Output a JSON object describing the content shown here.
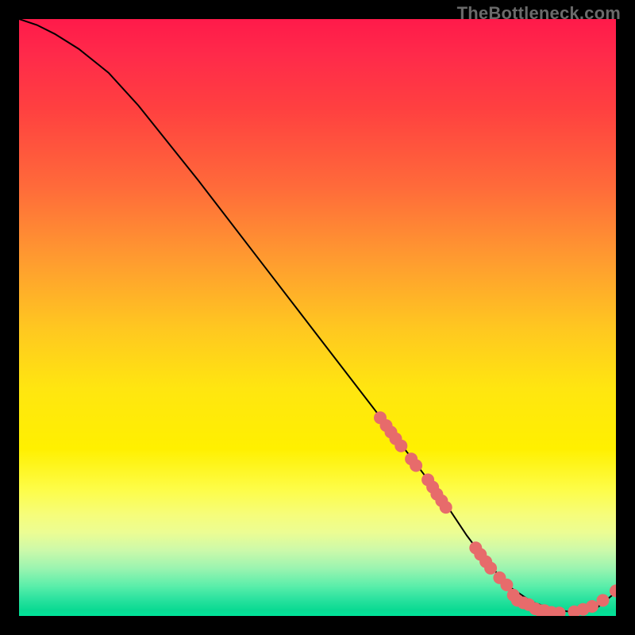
{
  "watermark": "TheBottleneck.com",
  "chart_data": {
    "type": "line",
    "title": "",
    "xlabel": "",
    "ylabel": "",
    "xlim": [
      0,
      100
    ],
    "ylim": [
      0,
      100
    ],
    "grid": false,
    "series": [
      {
        "name": "curve",
        "x": [
          0,
          3,
          6,
          10,
          15,
          20,
          30,
          40,
          50,
          60,
          68,
          72,
          75,
          78,
          82,
          86,
          90,
          94,
          97,
          100
        ],
        "y": [
          100,
          99,
          97.5,
          95,
          91,
          85.5,
          73,
          60,
          47,
          34,
          23.5,
          18,
          13.5,
          9.5,
          5,
          2.3,
          1,
          0.5,
          1.5,
          4
        ]
      }
    ],
    "markers": [
      {
        "x": 60.5,
        "y": 33.2
      },
      {
        "x": 61.5,
        "y": 31.9
      },
      {
        "x": 62.3,
        "y": 30.8
      },
      {
        "x": 63.1,
        "y": 29.7
      },
      {
        "x": 64.0,
        "y": 28.5
      },
      {
        "x": 65.7,
        "y": 26.3
      },
      {
        "x": 66.5,
        "y": 25.2
      },
      {
        "x": 68.5,
        "y": 22.8
      },
      {
        "x": 69.3,
        "y": 21.6
      },
      {
        "x": 70.0,
        "y": 20.4
      },
      {
        "x": 70.8,
        "y": 19.3
      },
      {
        "x": 71.5,
        "y": 18.2
      },
      {
        "x": 76.5,
        "y": 11.4
      },
      {
        "x": 77.3,
        "y": 10.3
      },
      {
        "x": 78.2,
        "y": 9.1
      },
      {
        "x": 79.0,
        "y": 8.0
      },
      {
        "x": 80.5,
        "y": 6.4
      },
      {
        "x": 81.7,
        "y": 5.2
      },
      {
        "x": 82.8,
        "y": 3.5
      },
      {
        "x": 83.5,
        "y": 2.6
      },
      {
        "x": 84.5,
        "y": 2.2
      },
      {
        "x": 85.4,
        "y": 1.9
      },
      {
        "x": 86.5,
        "y": 1.2
      },
      {
        "x": 87.3,
        "y": 0.9
      },
      {
        "x": 88.0,
        "y": 0.9
      },
      {
        "x": 89.2,
        "y": 0.6
      },
      {
        "x": 90.5,
        "y": 0.5
      },
      {
        "x": 93.0,
        "y": 0.7
      },
      {
        "x": 94.5,
        "y": 1.1
      },
      {
        "x": 96.0,
        "y": 1.6
      },
      {
        "x": 97.8,
        "y": 2.6
      },
      {
        "x": 100.0,
        "y": 4.2
      }
    ],
    "marker_style": {
      "color": "#e76b6b",
      "radius": 8
    },
    "line_style": {
      "color": "#000000",
      "width": 2
    }
  }
}
